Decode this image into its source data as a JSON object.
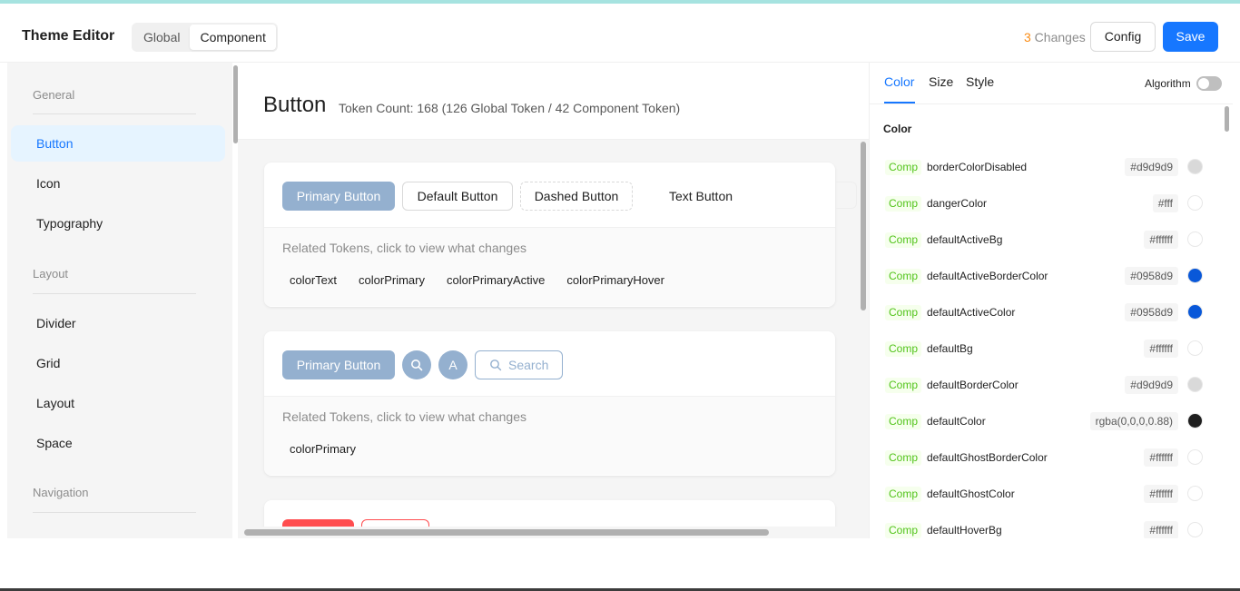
{
  "header": {
    "title": "Theme Editor",
    "segments": [
      "Global",
      "Component"
    ],
    "changes_count": "3",
    "changes_label": " Changes",
    "config_label": "Config",
    "save_label": "Save"
  },
  "sidebar": {
    "groups": {
      "general": "General",
      "layout": "Layout",
      "navigation": "Navigation"
    },
    "items": [
      "Button",
      "Icon",
      "Typography",
      "Divider",
      "Grid",
      "Layout",
      "Space"
    ]
  },
  "main": {
    "title": "Button",
    "token_count": "Token Count: 168 (126 Global Token / 42 Component Token)",
    "related_title": "Related Tokens, click to view what changes",
    "card1": {
      "buttons": [
        "Primary Button",
        "Default Button",
        "Dashed Button",
        "Text Button"
      ],
      "tokens": [
        "colorText",
        "colorPrimary",
        "colorPrimaryActive",
        "colorPrimaryHover"
      ]
    },
    "card2": {
      "primary": "Primary Button",
      "circle_text": "A",
      "search": "Search",
      "tokens": [
        "colorPrimary"
      ]
    }
  },
  "panel": {
    "tabs": [
      "Color",
      "Size",
      "Style"
    ],
    "algorithm_label": "Algorithm",
    "section_title": "Color",
    "badge": "Comp",
    "rows": [
      {
        "name": "borderColorDisabled",
        "value": "#d9d9d9",
        "color": "#d9d9d9"
      },
      {
        "name": "dangerColor",
        "value": "#fff",
        "color": "#ffffff"
      },
      {
        "name": "defaultActiveBg",
        "value": "#ffffff",
        "color": "#ffffff"
      },
      {
        "name": "defaultActiveBorderColor",
        "value": "#0958d9",
        "color": "#0958d9"
      },
      {
        "name": "defaultActiveColor",
        "value": "#0958d9",
        "color": "#0958d9"
      },
      {
        "name": "defaultBg",
        "value": "#ffffff",
        "color": "#ffffff"
      },
      {
        "name": "defaultBorderColor",
        "value": "#d9d9d9",
        "color": "#d9d9d9"
      },
      {
        "name": "defaultColor",
        "value": "rgba(0,0,0,0.88)",
        "color": "#1f1f1f"
      },
      {
        "name": "defaultGhostBorderColor",
        "value": "#ffffff",
        "color": "#ffffff"
      },
      {
        "name": "defaultGhostColor",
        "value": "#ffffff",
        "color": "#ffffff"
      },
      {
        "name": "defaultHoverBg",
        "value": "#ffffff",
        "color": "#ffffff"
      }
    ]
  },
  "colors": {
    "accent": "#1677ff",
    "primary_preview": "#94b0cf",
    "danger": "#ff4d4f",
    "changes": "#fa8c16",
    "badge_green": "#52c41a"
  }
}
